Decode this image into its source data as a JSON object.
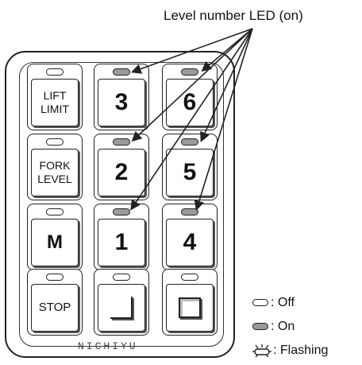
{
  "callout": "Level number LED (on)",
  "brand": "NICHIYU",
  "keys": {
    "lift_limit": {
      "line1": "LIFT",
      "line2": "LIMIT"
    },
    "fork_level": {
      "line1": "FORK",
      "line2": "LEVEL"
    },
    "m": "M",
    "stop": "STOP",
    "k3": "3",
    "k6": "6",
    "k2": "2",
    "k5": "5",
    "k1": "1",
    "k4": "4"
  },
  "legend": {
    "off": ": Off",
    "on": ": On",
    "flashing": ": Flashing"
  },
  "colors": {
    "led_on": "#9a9a9a",
    "outline": "#222222"
  },
  "icons": {
    "enter_key": "corner-bracket-icon",
    "page_key": "screen-box-icon"
  }
}
